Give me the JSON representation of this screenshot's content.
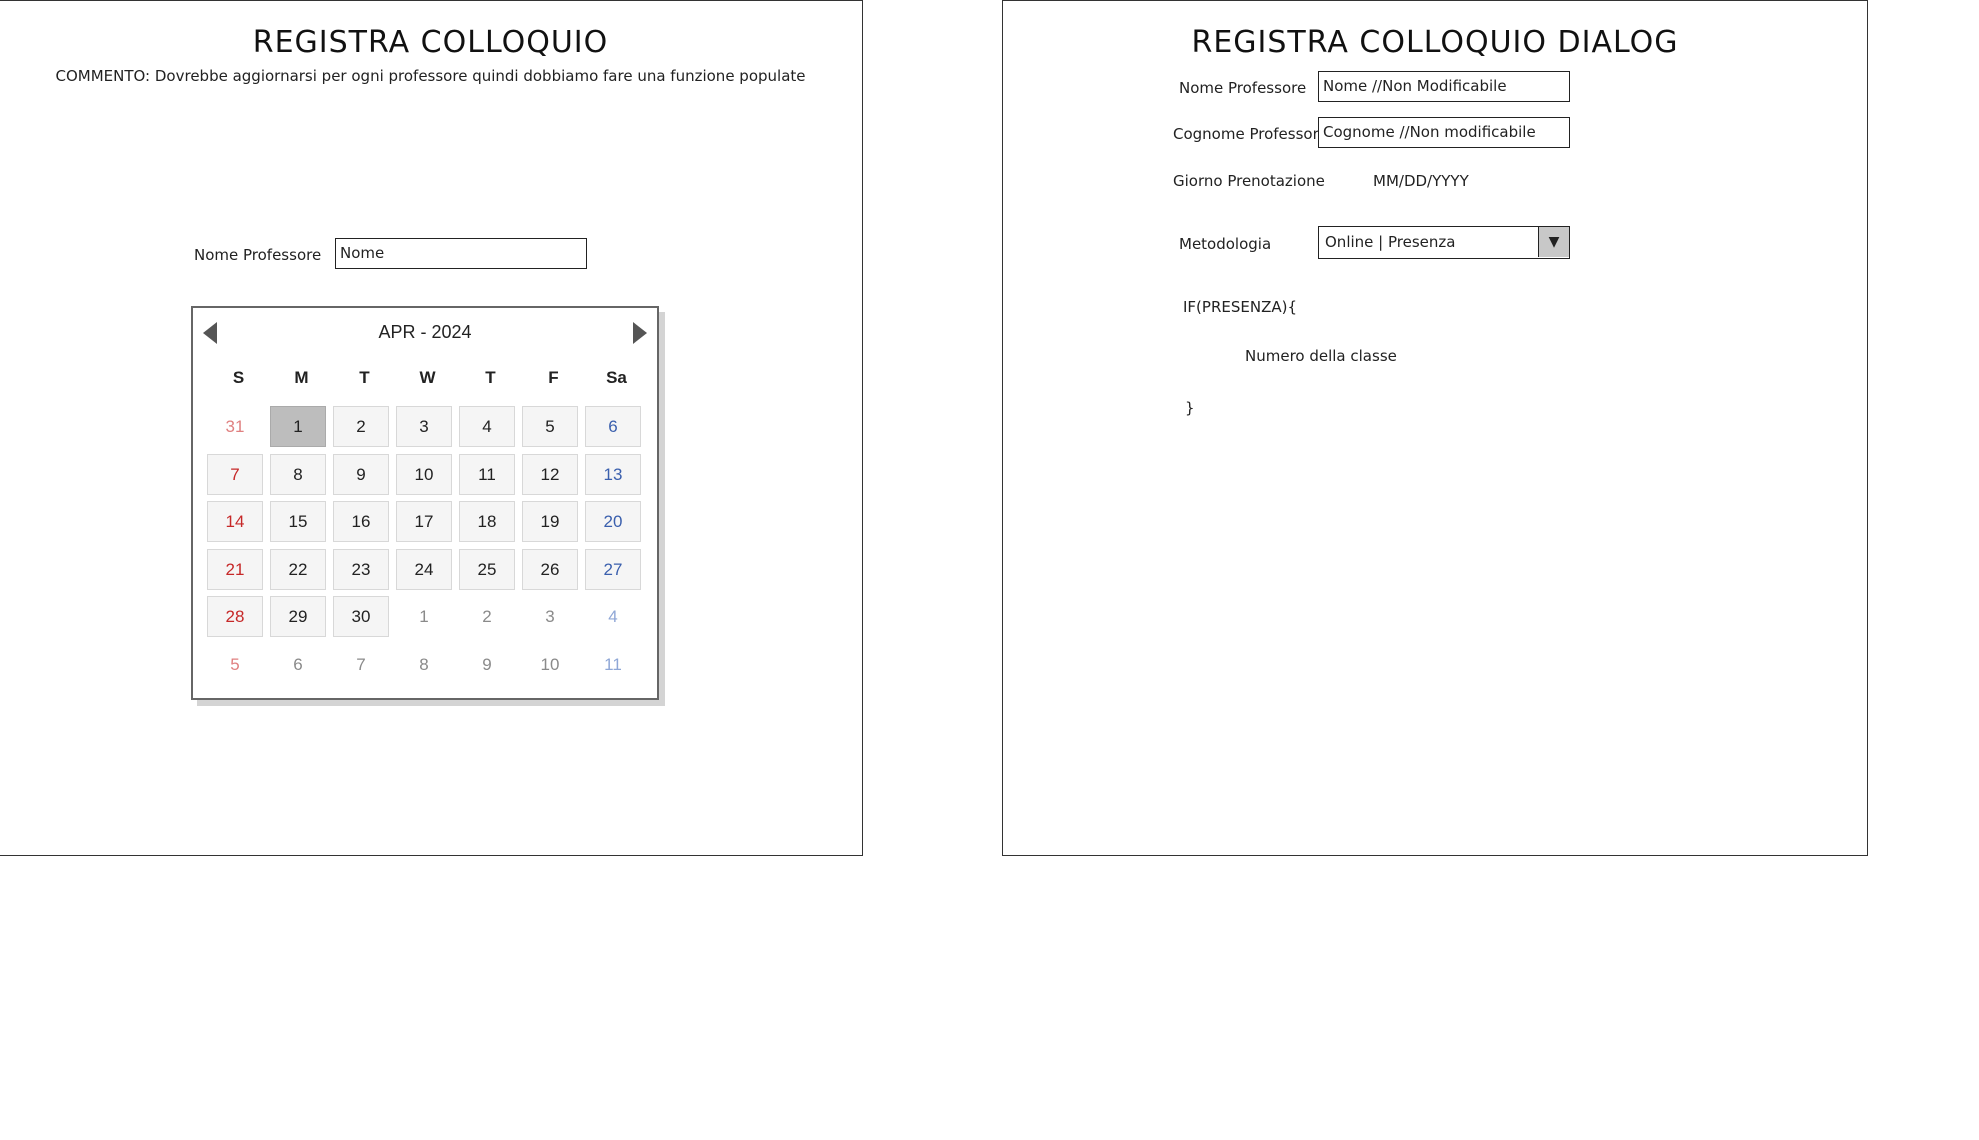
{
  "left": {
    "title": "REGISTRA COLLOQUIO",
    "comment": "COMMENTO: Dovrebbe aggiornarsi per ogni professore quindi dobbiamo fare una funzione populate",
    "nome_professore_label": "Nome Professore",
    "nome_professore_value": "Nome",
    "calendar": {
      "month_label": "APR - 2024",
      "prev_icon": "triangle-left",
      "next_icon": "triangle-right",
      "weekdays": [
        "S",
        "M",
        "T",
        "W",
        "T",
        "F",
        "Sa"
      ],
      "selected_day": "1",
      "colors": {
        "sunday": "#c62828",
        "saturday": "#3a5fad",
        "selected": "#bdbdbd"
      },
      "weeks": [
        [
          {
            "d": "31",
            "cur": false
          },
          {
            "d": "1",
            "cur": true
          },
          {
            "d": "2",
            "cur": true
          },
          {
            "d": "3",
            "cur": true
          },
          {
            "d": "4",
            "cur": true
          },
          {
            "d": "5",
            "cur": true
          },
          {
            "d": "6",
            "cur": true
          }
        ],
        [
          {
            "d": "7",
            "cur": true
          },
          {
            "d": "8",
            "cur": true
          },
          {
            "d": "9",
            "cur": true
          },
          {
            "d": "10",
            "cur": true
          },
          {
            "d": "11",
            "cur": true
          },
          {
            "d": "12",
            "cur": true
          },
          {
            "d": "13",
            "cur": true
          }
        ],
        [
          {
            "d": "14",
            "cur": true
          },
          {
            "d": "15",
            "cur": true
          },
          {
            "d": "16",
            "cur": true
          },
          {
            "d": "17",
            "cur": true
          },
          {
            "d": "18",
            "cur": true
          },
          {
            "d": "19",
            "cur": true
          },
          {
            "d": "20",
            "cur": true
          }
        ],
        [
          {
            "d": "21",
            "cur": true
          },
          {
            "d": "22",
            "cur": true
          },
          {
            "d": "23",
            "cur": true
          },
          {
            "d": "24",
            "cur": true
          },
          {
            "d": "25",
            "cur": true
          },
          {
            "d": "26",
            "cur": true
          },
          {
            "d": "27",
            "cur": true
          }
        ],
        [
          {
            "d": "28",
            "cur": true
          },
          {
            "d": "29",
            "cur": true
          },
          {
            "d": "30",
            "cur": true
          },
          {
            "d": "1",
            "cur": false
          },
          {
            "d": "2",
            "cur": false
          },
          {
            "d": "3",
            "cur": false
          },
          {
            "d": "4",
            "cur": false
          }
        ],
        [
          {
            "d": "5",
            "cur": false
          },
          {
            "d": "6",
            "cur": false
          },
          {
            "d": "7",
            "cur": false
          },
          {
            "d": "8",
            "cur": false
          },
          {
            "d": "9",
            "cur": false
          },
          {
            "d": "10",
            "cur": false
          },
          {
            "d": "11",
            "cur": false
          }
        ]
      ]
    }
  },
  "right": {
    "title": "REGISTRA COLLOQUIO DIALOG",
    "nome_professore_label": "Nome Professore",
    "nome_professore_value": "Nome //Non Modificabile",
    "cognome_professore_label": "Cognome Professore",
    "cognome_professore_value": "Cognome //Non modificabile",
    "giorno_label": "Giorno Prenotazione",
    "giorno_value": "MM/DD/YYYY",
    "metodologia_label": "Metodologia",
    "metodologia_value": "Online | Presenza",
    "dropdown_icon": "caret-down",
    "dropdown_glyph": "▼",
    "if_open": "IF(PRESENZA){",
    "numero_classe": "Numero della classe",
    "if_close": "}"
  }
}
